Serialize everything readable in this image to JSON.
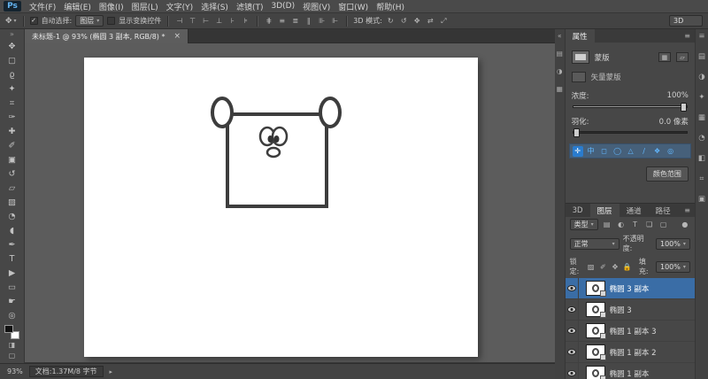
{
  "app": {
    "logo": "Ps",
    "workspace_badge": "3D"
  },
  "glyphs": {
    "caret": "▾",
    "menu": "≡",
    "collapse_left": "«",
    "collapse_right": "»",
    "close": "×",
    "arrow": "▸",
    "check": "✓",
    "filter_toggle": "●"
  },
  "menu": {
    "items": [
      "文件(F)",
      "编辑(E)",
      "图像(I)",
      "图层(L)",
      "文字(Y)",
      "选择(S)",
      "滤镜(T)",
      "3D(D)",
      "视图(V)",
      "窗口(W)",
      "帮助(H)"
    ]
  },
  "options": {
    "auto_select_label": "自动选择:",
    "auto_select_value": "图层",
    "show_transform_label": "显示变换控件",
    "mode_label": "3D 模式:",
    "align_icons": [
      {
        "name": "align-left-icon",
        "glyph": "⊣"
      },
      {
        "name": "align-h-center-icon",
        "glyph": "⊤"
      },
      {
        "name": "align-right-icon",
        "glyph": "⊢"
      },
      {
        "name": "align-top-icon",
        "glyph": "⊥"
      },
      {
        "name": "align-v-center-icon",
        "glyph": "⊦"
      },
      {
        "name": "align-bottom-icon",
        "glyph": "⊧"
      }
    ],
    "distribute_icons": [
      {
        "name": "distribute-top-icon",
        "glyph": "⋕"
      },
      {
        "name": "distribute-v-center-icon",
        "glyph": "≡"
      },
      {
        "name": "distribute-bottom-icon",
        "glyph": "≣"
      },
      {
        "name": "distribute-left-icon",
        "glyph": "∥"
      },
      {
        "name": "distribute-h-center-icon",
        "glyph": "⊪"
      },
      {
        "name": "distribute-right-icon",
        "glyph": "⊩"
      }
    ],
    "mode_icons": [
      {
        "name": "3d-rotate-icon",
        "glyph": "↻"
      },
      {
        "name": "3d-roll-icon",
        "glyph": "↺"
      },
      {
        "name": "3d-drag-icon",
        "glyph": "✥"
      },
      {
        "name": "3d-slide-icon",
        "glyph": "⇄"
      },
      {
        "name": "3d-scale-icon",
        "glyph": "⤢"
      }
    ]
  },
  "tools": [
    {
      "name": "move-tool",
      "glyph": "✥"
    },
    {
      "name": "marquee-tool",
      "glyph": "▢"
    },
    {
      "name": "lasso-tool",
      "glyph": "ϱ"
    },
    {
      "name": "quick-selection-tool",
      "glyph": "✦"
    },
    {
      "name": "crop-tool",
      "glyph": "⌗"
    },
    {
      "name": "eyedropper-tool",
      "glyph": "✑"
    },
    {
      "name": "healing-brush-tool",
      "glyph": "✚"
    },
    {
      "name": "brush-tool",
      "glyph": "✐"
    },
    {
      "name": "clone-stamp-tool",
      "glyph": "▣"
    },
    {
      "name": "history-brush-tool",
      "glyph": "↺"
    },
    {
      "name": "eraser-tool",
      "glyph": "▱"
    },
    {
      "name": "gradient-tool",
      "glyph": "▨"
    },
    {
      "name": "blur-tool",
      "glyph": "◔"
    },
    {
      "name": "dodge-tool",
      "glyph": "◖"
    },
    {
      "name": "pen-tool",
      "glyph": "✒"
    },
    {
      "name": "type-tool",
      "glyph": "T"
    },
    {
      "name": "path-selection-tool",
      "glyph": "▶"
    },
    {
      "name": "shape-tool",
      "glyph": "▭"
    },
    {
      "name": "hand-tool",
      "glyph": "☛"
    },
    {
      "name": "zoom-tool",
      "glyph": "◎"
    }
  ],
  "toolbar_footer": {
    "quick_mask_glyph": "◨",
    "screen_mode_glyph": "▢"
  },
  "document": {
    "tab_title": "未标题-1 @ 93% (椭圆 3 副本, RGB/8) *"
  },
  "properties": {
    "tab": "属性",
    "mask_label": "蒙版",
    "mask_type_label": "矢量蒙版",
    "add_mask_icons": [
      {
        "name": "add-pixel-mask-icon",
        "glyph": "▦"
      },
      {
        "name": "add-vector-mask-icon",
        "glyph": "▱"
      }
    ],
    "density_label": "浓度:",
    "density_value": "100%",
    "feather_label": "羽化:",
    "feather_value": "0.0 像素",
    "adjust_icons": [
      {
        "name": "mask-target-icon",
        "glyph": "✛"
      },
      {
        "name": "center-text-icon",
        "glyph": "中"
      },
      {
        "name": "rectangle-icon",
        "glyph": "◻"
      },
      {
        "name": "ellipse-icon",
        "glyph": "◯"
      },
      {
        "name": "polygon-icon",
        "glyph": "△"
      },
      {
        "name": "line-icon",
        "glyph": "∕"
      },
      {
        "name": "custom-shape-icon",
        "glyph": "❖"
      },
      {
        "name": "magnifier-icon",
        "glyph": "◎"
      }
    ],
    "color_range_button": "颜色范围"
  },
  "layers": {
    "tabs": [
      {
        "label": "3D",
        "active": false
      },
      {
        "label": "图层",
        "active": true
      },
      {
        "label": "通道",
        "active": false
      },
      {
        "label": "路径",
        "active": false
      }
    ],
    "filter_label": "类型",
    "filter_icons": [
      {
        "name": "pixel-filter-icon",
        "glyph": "▤"
      },
      {
        "name": "adjustment-filter-icon",
        "glyph": "◐"
      },
      {
        "name": "type-filter-icon",
        "glyph": "T"
      },
      {
        "name": "shape-filter-icon",
        "glyph": "❏"
      },
      {
        "name": "smart-object-filter-icon",
        "glyph": "▢"
      }
    ],
    "blend_mode": "正常",
    "opacity_label": "不透明度:",
    "opacity_value": "100%",
    "lock_label": "锁定:",
    "lock_icons": [
      {
        "name": "lock-transparency-icon",
        "glyph": "▨"
      },
      {
        "name": "lock-pixels-icon",
        "glyph": "✐"
      },
      {
        "name": "lock-position-icon",
        "glyph": "✥"
      },
      {
        "name": "lock-all-icon",
        "glyph": "🔒"
      }
    ],
    "fill_label": "填充:",
    "fill_value": "100%",
    "rows": [
      {
        "name": "椭圆 3 副本",
        "visible": true,
        "selected": true
      },
      {
        "name": "椭圆 3",
        "visible": true,
        "selected": false
      },
      {
        "name": "椭圆 1 副本 3",
        "visible": true,
        "selected": false
      },
      {
        "name": "椭圆 1 副本 2",
        "visible": true,
        "selected": false
      },
      {
        "name": "椭圆 1 副本",
        "visible": true,
        "selected": false
      }
    ]
  },
  "docks": {
    "left_icons": [
      {
        "name": "grid-panel-icon",
        "glyph": "▤"
      },
      {
        "name": "contrast-panel-icon",
        "glyph": "◑"
      },
      {
        "name": "table-panel-icon",
        "glyph": "▦"
      }
    ],
    "right_icons": [
      {
        "name": "hamburger-icon",
        "glyph": "≡"
      },
      {
        "name": "grid-icon",
        "glyph": "▤"
      },
      {
        "name": "contrast-icon",
        "glyph": "◑"
      },
      {
        "name": "star-icon",
        "glyph": "✦"
      },
      {
        "name": "table-icon",
        "glyph": "▦"
      },
      {
        "name": "clock-icon",
        "glyph": "◔"
      },
      {
        "name": "half-block-icon",
        "glyph": "◧"
      },
      {
        "name": "hash-icon",
        "glyph": "⌗"
      },
      {
        "name": "square-icon",
        "glyph": "▣"
      }
    ]
  },
  "status": {
    "zoom": "93%",
    "doc_info": "文档:1.37M/8 字节"
  }
}
